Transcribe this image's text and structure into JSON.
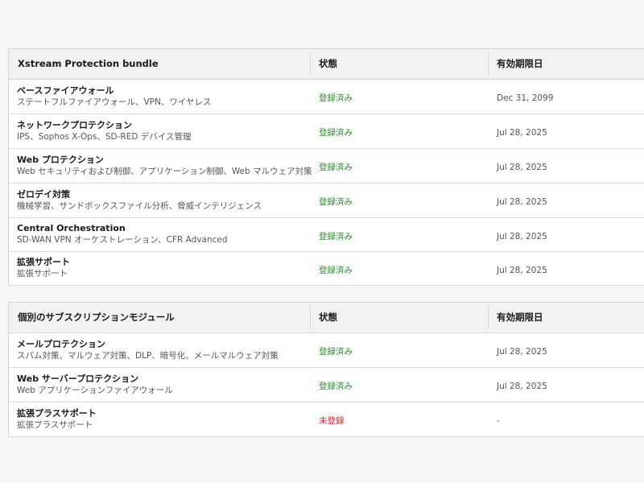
{
  "bundle_table": {
    "headers": {
      "name": "Xstream Protection bundle",
      "status": "状態",
      "expiry": "有効期限日"
    },
    "rows": [
      {
        "name": "ベースファイアウォール",
        "description": "ステートフルファイアウォール、VPN、ワイヤレス",
        "status": "登録済み",
        "expiry": "Dec 31, 2099"
      },
      {
        "name": "ネットワークプロテクション",
        "description": "IPS、Sophos X-Ops、SD-RED デバイス管理",
        "status": "登録済み",
        "expiry": "Jul 28, 2025"
      },
      {
        "name": "Web プロテクション",
        "description": "Web セキュリティおよび制御、アプリケーション制御、Web マルウェア対策",
        "status": "登録済み",
        "expiry": "Jul 28, 2025"
      },
      {
        "name": "ゼロデイ対策",
        "description": "機械学習、サンドボックスファイル分析、脅威インテリジェンス",
        "status": "登録済み",
        "expiry": "Jul 28, 2025"
      },
      {
        "name": "Central Orchestration",
        "description": "SD-WAN VPN オーケストレーション、CFR Advanced",
        "status": "登録済み",
        "expiry": "Jul 28, 2025"
      },
      {
        "name": "拡張サポート",
        "description": "拡張サポート",
        "status": "登録済み",
        "expiry": "Jul 28, 2025"
      }
    ]
  },
  "individual_table": {
    "headers": {
      "name": "個別のサブスクリプションモジュール",
      "status": "状態",
      "expiry": "有効期限日"
    },
    "rows": [
      {
        "name": "メールプロテクション",
        "description": "スパム対策、マルウェア対策、DLP、暗号化、メールマルウェア対策",
        "status": "登録済み",
        "expiry": "Jul 28, 2025"
      },
      {
        "name": "Web サーバープロテクション",
        "description": "Web アプリケーションファイアウォール",
        "status": "登録済み",
        "expiry": "Jul 28, 2025"
      },
      {
        "name": "拡張プラスサポート",
        "description": "拡張プラスサポート",
        "status": "未登録",
        "expiry": "-"
      }
    ]
  },
  "colors": {
    "registered": "#2e8b2e",
    "unregistered": "#d62020"
  }
}
